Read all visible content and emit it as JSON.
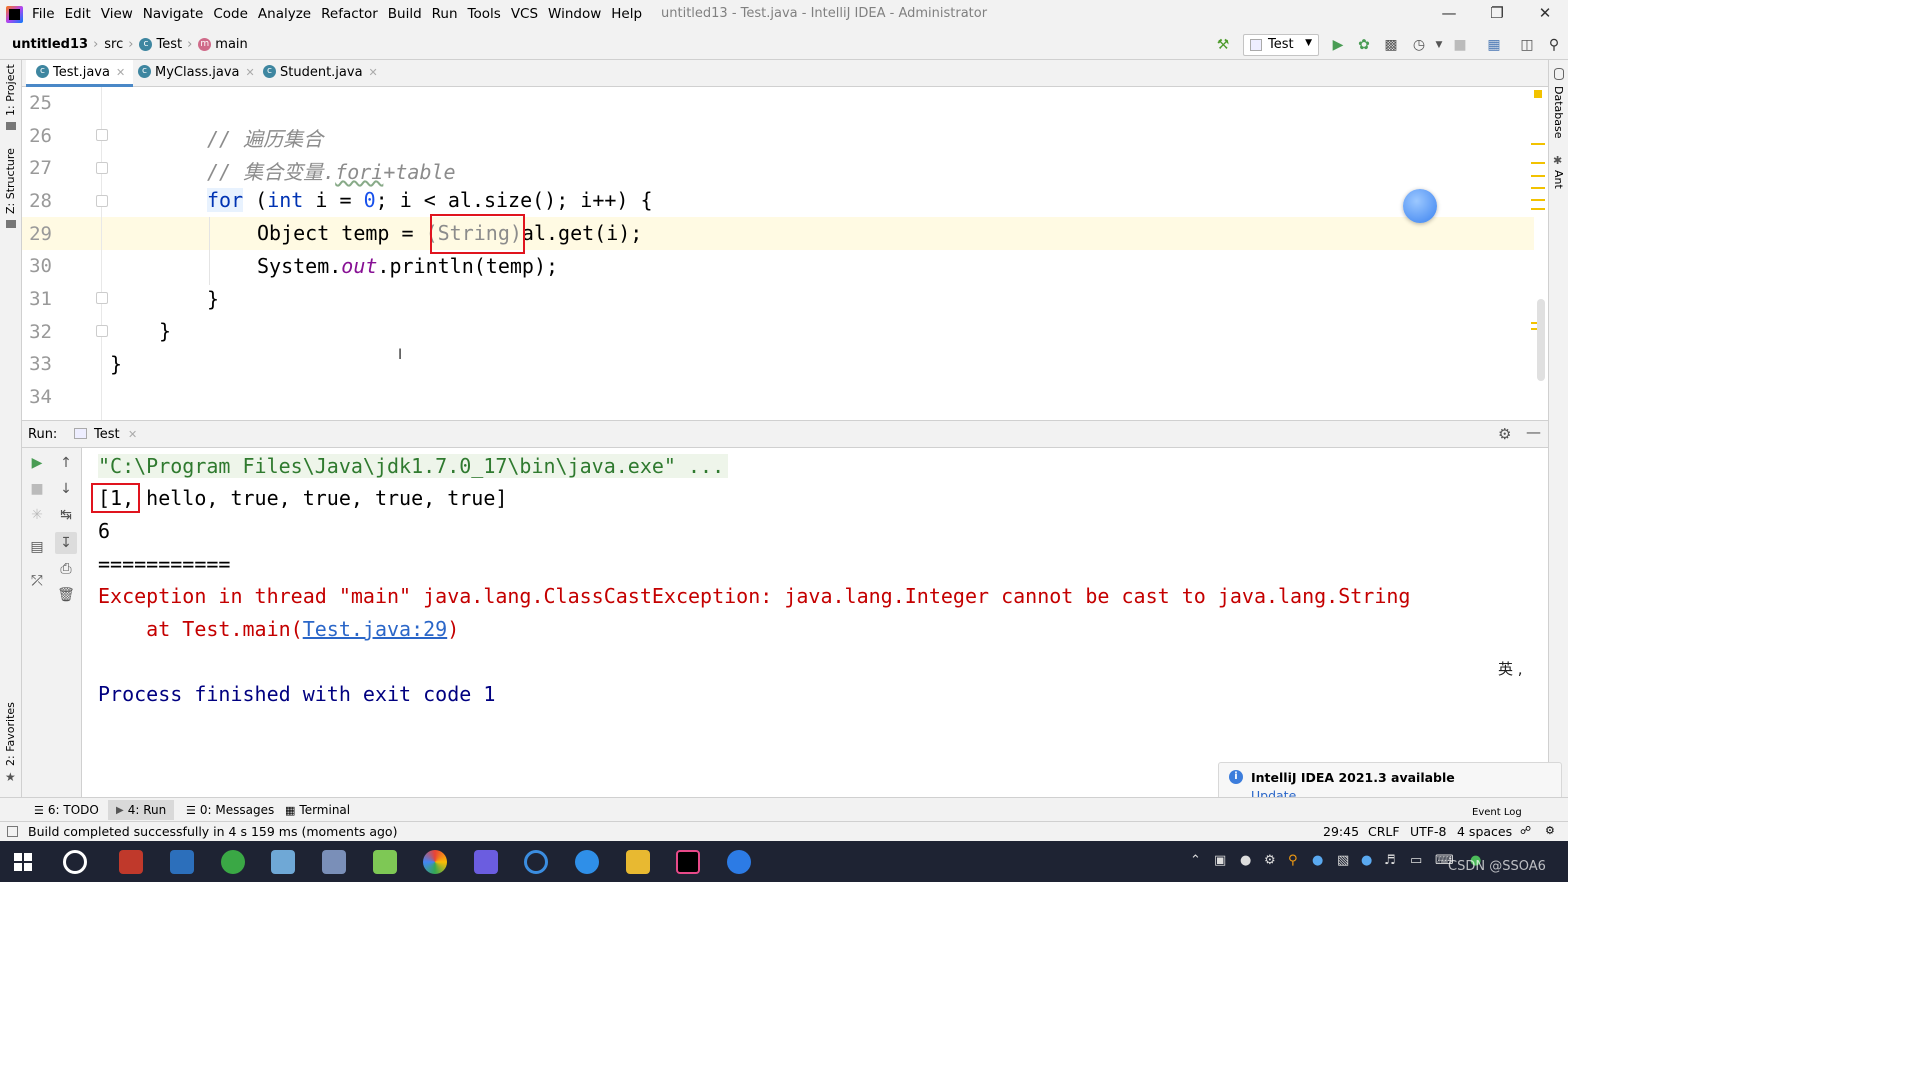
{
  "menu": [
    "File",
    "Edit",
    "View",
    "Navigate",
    "Code",
    "Analyze",
    "Refactor",
    "Build",
    "Run",
    "Tools",
    "VCS",
    "Window",
    "Help"
  ],
  "window_title": "untitled13 - Test.java - IntelliJ IDEA - Administrator",
  "breadcrumb": {
    "project": "untitled13",
    "src": "src",
    "cls": "Test",
    "method": "main"
  },
  "run_config": "Test",
  "left_tools": {
    "project": "1: Project",
    "structure": "Z: Structure",
    "favorites": "2: Favorites"
  },
  "right_tools": {
    "database": "Database",
    "ant": "Ant"
  },
  "tabs": [
    "Test.java",
    "MyClass.java",
    "Student.java"
  ],
  "lines": {
    "l25": "25",
    "l26": "26",
    "l27": "27",
    "l28": "28",
    "l29": "29",
    "l30": "30",
    "l31": "31",
    "l32": "32",
    "l33": "33",
    "l34": "34"
  },
  "code": {
    "c26": "// 遍历集合",
    "c27a": "// 集合变量.",
    "c27b": "fori",
    "c27c": "+table",
    "for_kw": "for",
    "for_a": " (",
    "int_kw": "int",
    "for_b": " i = ",
    "zero": "0",
    "for_c": "; i < al.size(); i++) {",
    "l29a": "Object temp = ",
    "l29cast": "(String)",
    "l29b": "al.get(i);",
    "l30a": "System.",
    "l30out": "out",
    "l30b": ".println(temp);",
    "brace31": "}",
    "brace32": "}",
    "brace33": "}"
  },
  "run_panel": {
    "label": "Run:",
    "tab": "Test"
  },
  "console": {
    "cmd": "\"C:\\Program Files\\Java\\jdk1.7.0_17\\bin\\java.exe\" ...",
    "out1a": "[1,",
    "out1b": " hello, true, true, true, true]",
    "out2": "6",
    "out3": "===========",
    "exc": "Exception in thread \"main\" java.lang.ClassCastException: java.lang.Integer cannot be cast to java.lang.String",
    "at": "    at Test.main(",
    "atlink": "Test.java:29",
    "atclose": ")",
    "finish": "Process finished with exit code 1"
  },
  "ime": "英 ,",
  "notification": {
    "title": "IntelliJ IDEA 2021.3 available",
    "action": "Update..."
  },
  "bottom_tabs": {
    "todo": "6: TODO",
    "run": "4: Run",
    "messages": "0: Messages",
    "terminal": "Terminal",
    "eventlog": "Event Log"
  },
  "status": {
    "msg": "Build completed successfully in 4 s 159 ms (moments ago)",
    "pos": "29:45",
    "eol": "CRLF",
    "enc": "UTF-8",
    "indent": "4 spaces"
  },
  "watermark": "CSDN @SSOA6",
  "colors": {
    "keyword": "#0033b3",
    "number": "#1750eb",
    "comment": "#8c8c8c",
    "error": "#c40000",
    "link": "#2a66c8",
    "highlight": "#e0141e"
  }
}
